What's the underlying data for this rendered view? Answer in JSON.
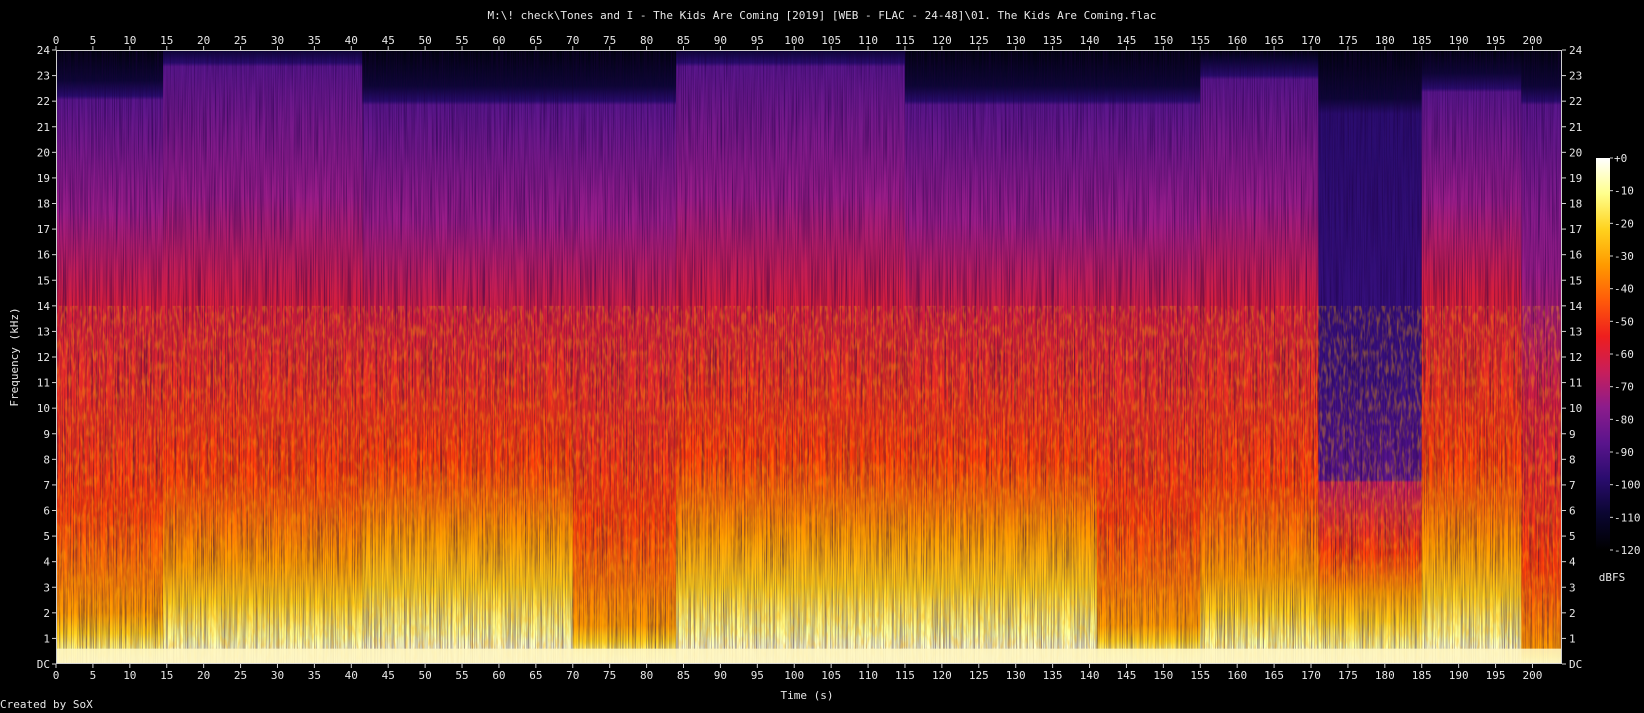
{
  "chart_data": {
    "type": "heatmap",
    "subtype": "spectrogram",
    "title": "M:\\! check\\Tones and I - The Kids Are Coming [2019] [WEB - FLAC - 24-48]\\01. The Kids Are Coming.flac",
    "xlabel": "Time (s)",
    "ylabel": "Frequency (kHz)",
    "x_ticks": [
      0,
      5,
      10,
      15,
      20,
      25,
      30,
      35,
      40,
      45,
      50,
      55,
      60,
      65,
      70,
      75,
      80,
      85,
      90,
      95,
      100,
      105,
      110,
      115,
      120,
      125,
      130,
      135,
      140,
      145,
      150,
      155,
      160,
      165,
      170,
      175,
      180,
      185,
      190,
      195,
      200
    ],
    "xlim": [
      0,
      204
    ],
    "y_ticks": [
      {
        "v": 0,
        "label": "DC"
      },
      {
        "v": 1,
        "label": "1"
      },
      {
        "v": 2,
        "label": "2"
      },
      {
        "v": 3,
        "label": "3"
      },
      {
        "v": 4,
        "label": "4"
      },
      {
        "v": 5,
        "label": "5"
      },
      {
        "v": 6,
        "label": "6"
      },
      {
        "v": 7,
        "label": "7"
      },
      {
        "v": 8,
        "label": "8"
      },
      {
        "v": 9,
        "label": "9"
      },
      {
        "v": 10,
        "label": "10"
      },
      {
        "v": 11,
        "label": "11"
      },
      {
        "v": 12,
        "label": "12"
      },
      {
        "v": 13,
        "label": "13"
      },
      {
        "v": 14,
        "label": "14"
      },
      {
        "v": 15,
        "label": "15"
      },
      {
        "v": 16,
        "label": "16"
      },
      {
        "v": 17,
        "label": "17"
      },
      {
        "v": 18,
        "label": "18"
      },
      {
        "v": 19,
        "label": "19"
      },
      {
        "v": 20,
        "label": "20"
      },
      {
        "v": 21,
        "label": "21"
      },
      {
        "v": 22,
        "label": "22"
      },
      {
        "v": 23,
        "label": "23"
      },
      {
        "v": 24,
        "label": "24"
      }
    ],
    "ylim": [
      0,
      24
    ],
    "colorbar": {
      "unit": "dBFS",
      "ticks": [
        {
          "v": 0,
          "label": "+0"
        },
        {
          "v": -10,
          "label": "-10"
        },
        {
          "v": -20,
          "label": "-20"
        },
        {
          "v": -30,
          "label": "-30"
        },
        {
          "v": -40,
          "label": "-40"
        },
        {
          "v": -50,
          "label": "-50"
        },
        {
          "v": -60,
          "label": "-60"
        },
        {
          "v": -70,
          "label": "-70"
        },
        {
          "v": -80,
          "label": "-80"
        },
        {
          "v": -90,
          "label": "-90"
        },
        {
          "v": -100,
          "label": "-100"
        },
        {
          "v": -110,
          "label": "-110"
        },
        {
          "v": -120,
          "label": "-120"
        }
      ],
      "range": [
        -120,
        0
      ],
      "colors": [
        "#000000",
        "#0a0630",
        "#2a0c6e",
        "#5a148c",
        "#8c1c8c",
        "#c81e5a",
        "#ee1e1e",
        "#ff5a0a",
        "#ff9a00",
        "#ffd21e",
        "#ffff8c",
        "#ffffff"
      ]
    },
    "segments": [
      {
        "t0": 0,
        "t1": 14.5,
        "top_khz": 22.2,
        "mid_khz": 14.0,
        "loud_khz": 2.0,
        "texture": "sparse"
      },
      {
        "t0": 14.5,
        "t1": 41.5,
        "top_khz": 23.5,
        "mid_khz": 14.0,
        "loud_khz": 4.0,
        "texture": "dense"
      },
      {
        "t0": 41.5,
        "t1": 70,
        "top_khz": 22.0,
        "mid_khz": 13.5,
        "loud_khz": 5.0,
        "texture": "dense"
      },
      {
        "t0": 70,
        "t1": 84,
        "top_khz": 22.0,
        "mid_khz": 13.5,
        "loud_khz": 1.5,
        "texture": "dense"
      },
      {
        "t0": 84,
        "t1": 115,
        "top_khz": 23.5,
        "mid_khz": 14.0,
        "loud_khz": 5.0,
        "texture": "dense"
      },
      {
        "t0": 115,
        "t1": 141,
        "top_khz": 22.0,
        "mid_khz": 13.5,
        "loud_khz": 5.0,
        "texture": "dense"
      },
      {
        "t0": 141,
        "t1": 155,
        "top_khz": 22.0,
        "mid_khz": 13.5,
        "loud_khz": 1.5,
        "texture": "dense"
      },
      {
        "t0": 155,
        "t1": 171,
        "top_khz": 23.0,
        "mid_khz": 14.0,
        "loud_khz": 3.5,
        "texture": "dense"
      },
      {
        "t0": 171,
        "t1": 185,
        "top_khz": 21.5,
        "mid_khz": 7.2,
        "loud_khz": 2.8,
        "texture": "quiet"
      },
      {
        "t0": 185,
        "t1": 198.5,
        "top_khz": 22.5,
        "mid_khz": 14.5,
        "loud_khz": 4.5,
        "texture": "dense"
      },
      {
        "t0": 198.5,
        "t1": 204,
        "top_khz": 22.0,
        "mid_khz": 10.0,
        "loud_khz": 0.5,
        "texture": "tail"
      }
    ]
  },
  "footer": {
    "credit": "Created by SoX"
  }
}
